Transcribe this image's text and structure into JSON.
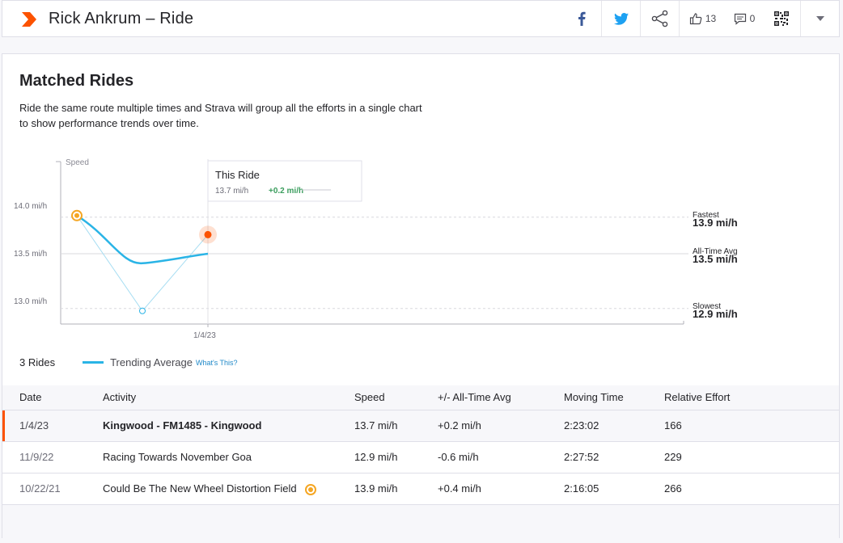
{
  "header": {
    "title": "Rick Ankrum – Ride",
    "kudos_count": "13",
    "comment_count": "0"
  },
  "section": {
    "title": "Matched Rides",
    "description": "Ride the same route multiple times and Strava will group all the efforts in a single chart to show performance trends over time."
  },
  "chart_data": {
    "type": "line",
    "ylabel": "Speed",
    "y_ticks": [
      "14.0 mi/h",
      "13.5 mi/h",
      "13.0 mi/h"
    ],
    "x_ticks": [
      "1/4/23"
    ],
    "ylim": [
      12.8,
      14.15
    ],
    "series": [
      {
        "values": [
          13.9,
          12.9,
          13.7
        ]
      },
      {
        "name": "Trending Average",
        "values": [
          13.9,
          13.4,
          13.5
        ]
      }
    ],
    "tooltip": {
      "title": "This Ride",
      "value": "13.7 mi/h",
      "delta": "+0.2 mi/h"
    },
    "reference_lines": [
      {
        "label": "Fastest",
        "value_text": "13.9 mi/h",
        "value": 13.9
      },
      {
        "label": "All-Time Avg",
        "value_text": "13.5 mi/h",
        "value": 13.5
      },
      {
        "label": "Slowest",
        "value_text": "12.9 mi/h",
        "value": 12.9
      }
    ],
    "colors": {
      "trend": "#2ab4e6",
      "rides": "#a6ddf2",
      "current": "#fc5200",
      "best": "#f5a623"
    }
  },
  "legend": {
    "rides": "3 Rides",
    "trend": "Trending Average",
    "what": "What's This?"
  },
  "table": {
    "headers": [
      "Date",
      "Activity",
      "Speed",
      "+/- All-Time Avg",
      "Moving Time",
      "Relative Effort"
    ],
    "rows": [
      {
        "date": "1/4/23",
        "activity": "Kingwood - FM1485 - Kingwood",
        "speed": "13.7 mi/h",
        "delta": "+0.2 mi/h",
        "time": "2:23:02",
        "effort": "166"
      },
      {
        "date": "11/9/22",
        "activity": "Racing Towards November Goa",
        "speed": "12.9 mi/h",
        "delta": "-0.6 mi/h",
        "time": "2:27:52",
        "effort": "229"
      },
      {
        "date": "10/22/21",
        "activity": "Could Be The New Wheel Distortion Field",
        "speed": "13.9 mi/h",
        "delta": "+0.4 mi/h",
        "time": "2:16:05",
        "effort": "266"
      }
    ]
  }
}
